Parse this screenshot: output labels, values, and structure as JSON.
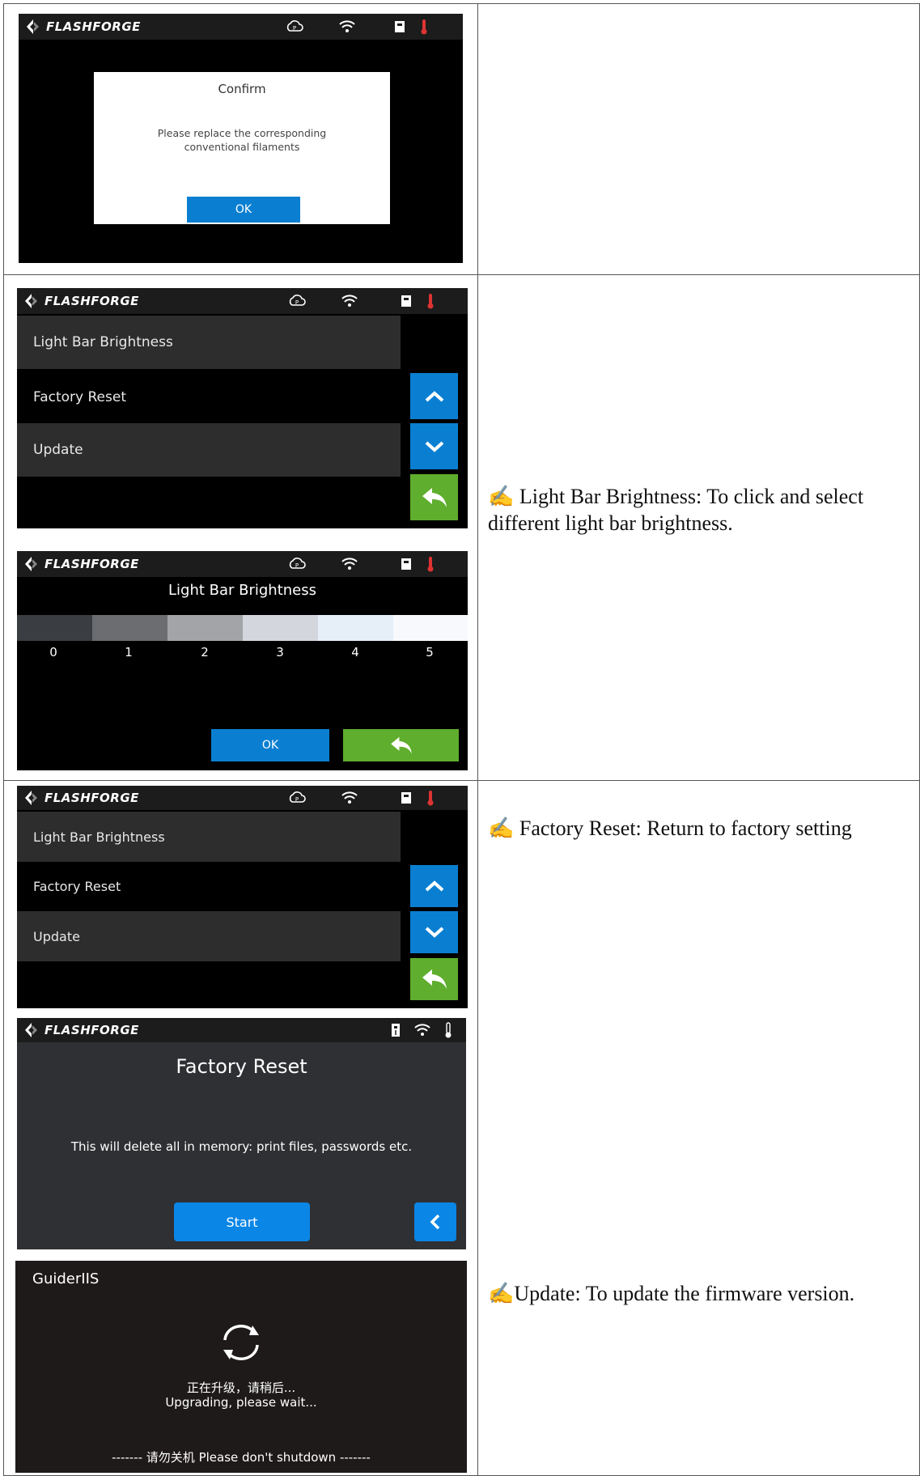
{
  "brand": "FLASHFORGE",
  "row1": {
    "dialog_title": "Confirm",
    "dialog_message_line1": "Please replace the corresponding",
    "dialog_message_line2": "conventional filaments",
    "ok_label": "OK"
  },
  "settings_menu": {
    "items": [
      "Light Bar Brightness",
      "Factory Reset",
      "Update"
    ]
  },
  "brightness": {
    "title": "Light Bar Brightness",
    "levels": [
      "0",
      "1",
      "2",
      "3",
      "4",
      "5"
    ],
    "ok_label": "OK"
  },
  "factory_reset": {
    "title": "Factory Reset",
    "message": "This will delete all in memory: print files, passwords etc.",
    "start_label": "Start"
  },
  "update_screen": {
    "title": "GuiderIIS",
    "line_cn": "正在升级，请稍后...",
    "line_en": "Upgrading, please wait...",
    "footer": "------- 请勿关机 Please don't shutdown -------"
  },
  "descriptions": {
    "brightness": "✍ Light Bar Brightness: To click and select different light bar brightness.",
    "factory": "✍ Factory Reset: Return to factory setting",
    "update": "✍Update: To update the firmware version."
  },
  "colors": {
    "blue_button": "#0a7fd1",
    "green_button": "#5fae2e",
    "swatches": [
      "#3a3d42",
      "#6b6d70",
      "#a2a4a7",
      "#d3d6dc",
      "#e6eef8",
      "#f7f9fc"
    ]
  }
}
